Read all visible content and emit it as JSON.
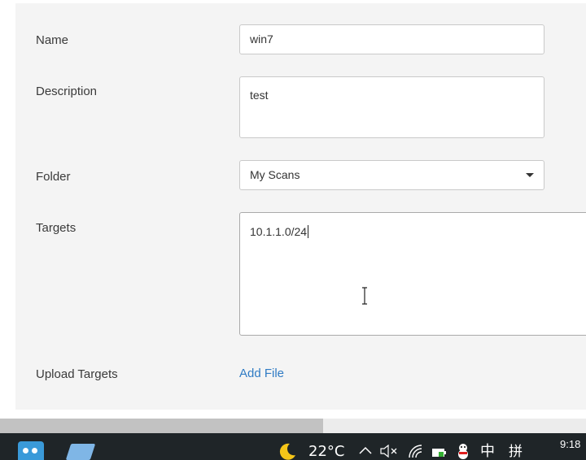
{
  "form": {
    "name": {
      "label": "Name",
      "value": "win7"
    },
    "description": {
      "label": "Description",
      "value": "test"
    },
    "folder": {
      "label": "Folder",
      "value": "My Scans"
    },
    "targets": {
      "label": "Targets",
      "value": "10.1.1.0/24"
    },
    "upload": {
      "label": "Upload Targets",
      "link": "Add File"
    }
  },
  "taskbar": {
    "weather_icon": "moon-icon",
    "temperature": "22°C",
    "tray_up": "^",
    "volume": "🔈×",
    "ime_mode": "中",
    "ime_pinyin": "拼",
    "time": "9:18"
  },
  "colors": {
    "link": "#2f7bc4",
    "panel": "#f4f4f4",
    "taskbar": "#1f2528"
  }
}
